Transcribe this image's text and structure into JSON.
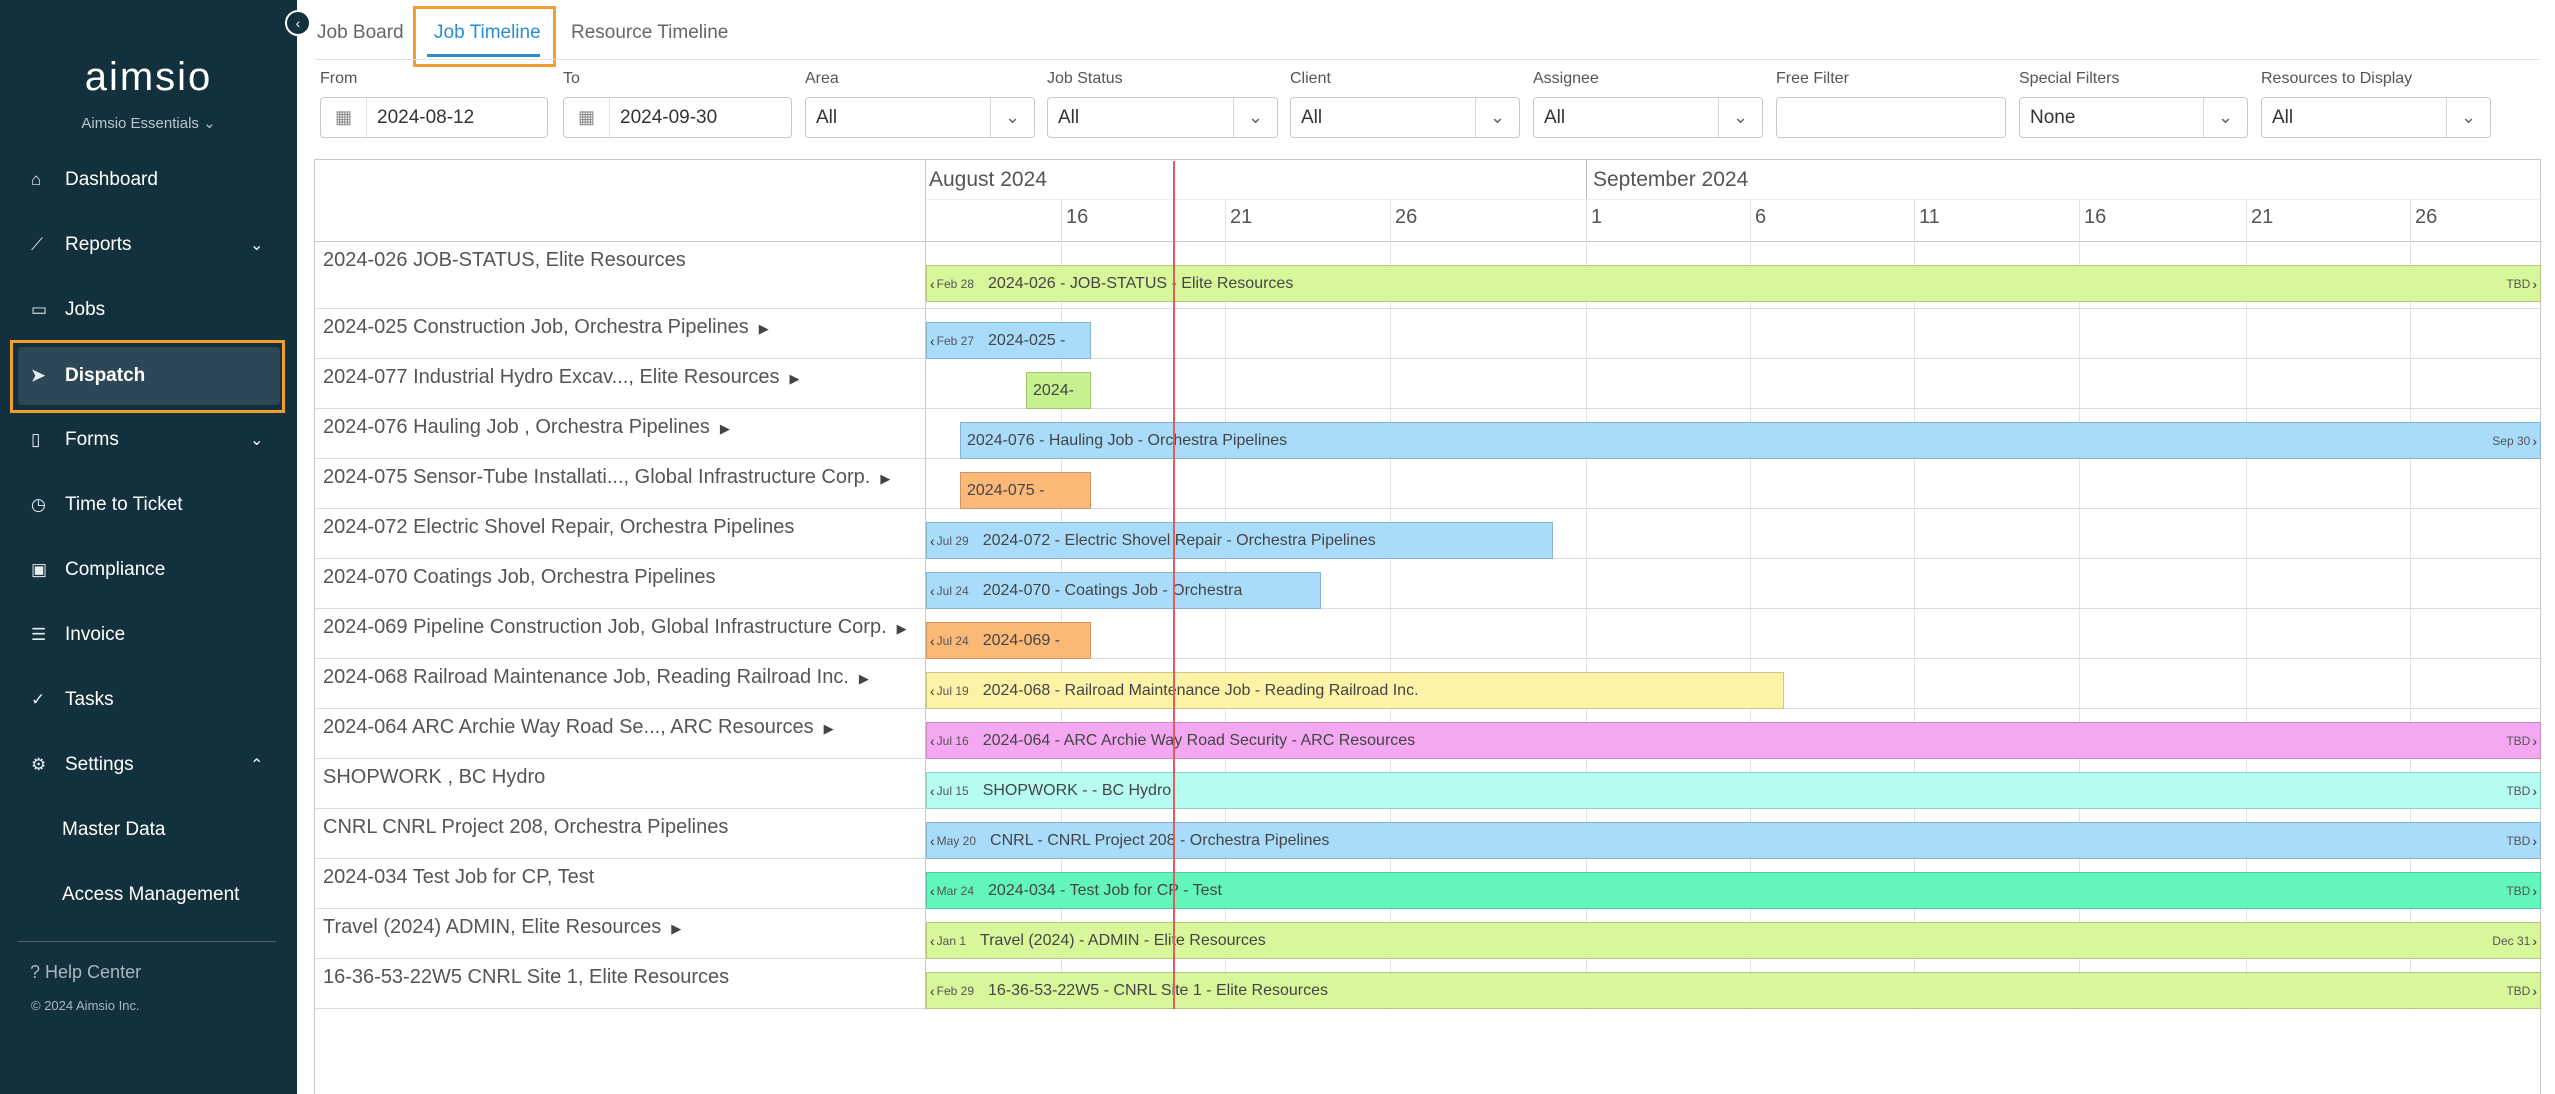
{
  "sidebar": {
    "logo": "aimsio",
    "subtitle": "Aimsio Essentials ⌄",
    "items": [
      {
        "label": "Dashboard",
        "icon": "home-icon"
      },
      {
        "label": "Reports",
        "icon": "chart-icon"
      },
      {
        "label": "Jobs",
        "icon": "folder-icon"
      },
      {
        "label": "Dispatch",
        "icon": "send-icon"
      },
      {
        "label": "Forms",
        "icon": "clipboard-icon"
      },
      {
        "label": "Time to Ticket",
        "icon": "clock-icon"
      },
      {
        "label": "Compliance",
        "icon": "compliance-icon"
      },
      {
        "label": "Invoice",
        "icon": "invoice-icon"
      },
      {
        "label": "Tasks",
        "icon": "check-circle-icon"
      },
      {
        "label": "Settings",
        "icon": "gear-icon"
      }
    ],
    "sub_items": [
      "Master Data",
      "Access Management"
    ],
    "help": "Help Center",
    "copyright": "© 2024 Aimsio Inc."
  },
  "tabs": [
    "Job Board",
    "Job Timeline",
    "Resource Timeline"
  ],
  "active_tab": "Job Timeline",
  "filters": {
    "from": {
      "label": "From",
      "value": "2024-08-12"
    },
    "to": {
      "label": "To",
      "value": "2024-09-30"
    },
    "area": {
      "label": "Area",
      "value": "All"
    },
    "job_status": {
      "label": "Job Status",
      "value": "All"
    },
    "client": {
      "label": "Client",
      "value": "All"
    },
    "assignee": {
      "label": "Assignee",
      "value": "All"
    },
    "free_filter": {
      "label": "Free Filter",
      "value": ""
    },
    "special_filters": {
      "label": "Special Filters",
      "value": "None"
    },
    "resources": {
      "label": "Resources to Display",
      "value": "All"
    }
  },
  "timeline": {
    "months": [
      "August 2024",
      "September 2024"
    ],
    "days": [
      "16",
      "21",
      "26",
      "1",
      "6",
      "11",
      "16",
      "21",
      "26"
    ],
    "rows": [
      {
        "label": "2024-026 JOB-STATUS, Elite Resources",
        "expand": false,
        "bar": {
          "text": "2024-026 - JOB-STATUS - Elite Resources",
          "start": "Feb 28",
          "end": "TBD",
          "color": "#d8f79b"
        }
      },
      {
        "label": "2024-025 Construction Job, Orchestra Pipelines",
        "expand": true,
        "bar": {
          "text": "2024-025 -",
          "start": "Feb 27",
          "end": "",
          "color": "#a9dcfa"
        }
      },
      {
        "label": "2024-077 Industrial Hydro Excav..., Elite Resources",
        "expand": true,
        "bar": {
          "text": "2024-",
          "start": "",
          "end": "",
          "color": "#c6f18e"
        }
      },
      {
        "label": "2024-076 Hauling Job , Orchestra Pipelines",
        "expand": true,
        "bar": {
          "text": "2024-076 - Hauling Job - Orchestra Pipelines",
          "start": "",
          "end": "Sep 30",
          "color": "#a9dcfa"
        }
      },
      {
        "label": "2024-075 Sensor-Tube Installati..., Global Infrastructure Corp.",
        "expand": true,
        "bar": {
          "text": "2024-075 -",
          "start": "",
          "end": "",
          "color": "#fcb876"
        }
      },
      {
        "label": "2024-072 Electric Shovel Repair, Orchestra Pipelines",
        "expand": false,
        "bar": {
          "text": "2024-072 - Electric Shovel Repair - Orchestra Pipelines",
          "start": "Jul 29",
          "end": "",
          "color": "#a9dcfa"
        }
      },
      {
        "label": "2024-070 Coatings Job, Orchestra Pipelines",
        "expand": false,
        "bar": {
          "text": "2024-070 - Coatings Job - Orchestra",
          "start": "Jul 24",
          "end": "",
          "color": "#a9dcfa"
        }
      },
      {
        "label": "2024-069 Pipeline Construction Job, Global Infrastructure Corp.",
        "expand": true,
        "bar": {
          "text": "2024-069 -",
          "start": "Jul 24",
          "end": "",
          "color": "#fcb876"
        }
      },
      {
        "label": "2024-068 Railroad Maintenance Job, Reading Railroad Inc.",
        "expand": true,
        "bar": {
          "text": "2024-068 - Railroad Maintenance Job - Reading Railroad Inc.",
          "start": "Jul 19",
          "end": "",
          "color": "#fdf3a6"
        }
      },
      {
        "label": "2024-064 ARC Archie Way Road Se..., ARC Resources",
        "expand": true,
        "bar": {
          "text": "2024-064 - ARC Archie Way Road Security - ARC Resources",
          "start": "Jul 16",
          "end": "TBD",
          "color": "#f4a8f2"
        }
      },
      {
        "label": "SHOPWORK , BC Hydro",
        "expand": false,
        "bar": {
          "text": "SHOPWORK - - BC Hydro",
          "start": "Jul 15",
          "end": "TBD",
          "color": "#b7fcf3"
        }
      },
      {
        "label": "CNRL CNRL Project 208, Orchestra Pipelines",
        "expand": false,
        "bar": {
          "text": "CNRL - CNRL Project 208 - Orchestra Pipelines",
          "start": "May 20",
          "end": "TBD",
          "color": "#a9dcfa"
        }
      },
      {
        "label": "2024-034 Test Job for CP, Test",
        "expand": false,
        "bar": {
          "text": "2024-034 - Test Job for CP - Test",
          "start": "Mar 24",
          "end": "TBD",
          "color": "#62f6bb"
        }
      },
      {
        "label": "Travel (2024) ADMIN, Elite Resources",
        "expand": true,
        "bar": {
          "text": "Travel (2024) - ADMIN - Elite Resources",
          "start": "Jan 1",
          "end": "Dec 31",
          "color": "#d8f79b"
        }
      },
      {
        "label": "16-36-53-22W5 CNRL Site 1, Elite Resources",
        "expand": false,
        "bar": {
          "text": "16-36-53-22W5 - CNRL Site 1 - Elite Resources",
          "start": "Feb 29",
          "end": "TBD",
          "color": "#d8f79b"
        }
      }
    ]
  },
  "colors": {
    "accent": "#2a8dd4",
    "sidebar_bg": "#13303d",
    "highlight": "#f39c33",
    "today_line": "#e55a5a"
  }
}
